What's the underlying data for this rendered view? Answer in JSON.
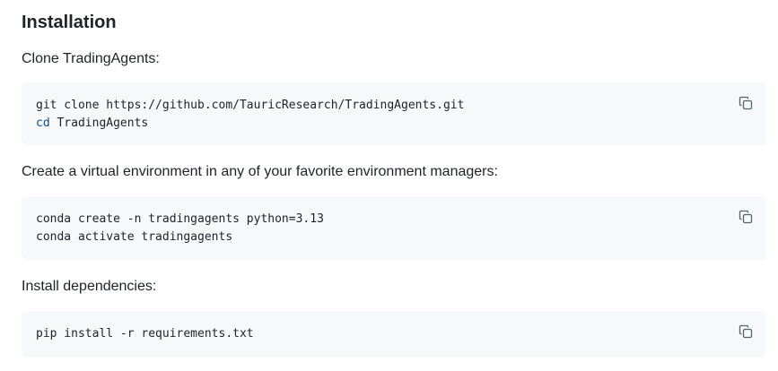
{
  "section": {
    "title": "Installation"
  },
  "steps": [
    {
      "text": "Clone TradingAgents:",
      "lines": [
        {
          "prefix": "",
          "rest": "git clone https://github.com/TauricResearch/TradingAgents.git"
        },
        {
          "prefix": "cd",
          "rest": " TradingAgents"
        }
      ]
    },
    {
      "text": "Create a virtual environment in any of your favorite environment managers:",
      "lines": [
        {
          "prefix": "",
          "rest": "conda create -n tradingagents python=3.13"
        },
        {
          "prefix": "",
          "rest": "conda activate tradingagents"
        }
      ]
    },
    {
      "text": "Install dependencies:",
      "lines": [
        {
          "prefix": "",
          "rest": "pip install -r requirements.txt"
        }
      ]
    }
  ],
  "icons": {
    "copy": "copy-icon"
  },
  "colors": {
    "code_bg": "#f6f8fa",
    "keyword": "#0550ae",
    "text": "#1f2328"
  }
}
